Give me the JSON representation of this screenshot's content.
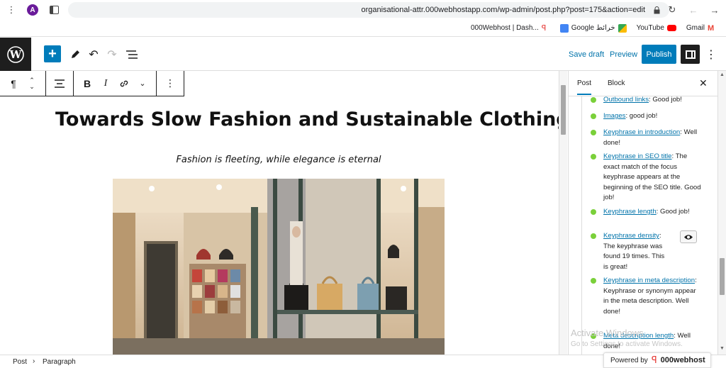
{
  "browser": {
    "url": "organisational-attr.000webhostapp.com/wp-admin/post.php?post=175&action=edit",
    "avatar_letter": "A",
    "bookmarks": [
      {
        "label": "000Webhost | Dash...",
        "icon": "webhost-icon",
        "color": "#e53935"
      },
      {
        "label": "Google خرائط",
        "icon": "maps-icon",
        "color": "#4285f4"
      },
      {
        "label": "YouTube",
        "icon": "youtube-icon",
        "color": "#ff0000"
      },
      {
        "label": "Gmail",
        "icon": "gmail-icon",
        "color": "#ea4335"
      }
    ]
  },
  "header": {
    "save_draft": "Save draft",
    "preview": "Preview",
    "publish": "Publish"
  },
  "post": {
    "title": "Towards Slow Fashion and Sustainable Clothing",
    "tagline": "Fashion is fleeting, while elegance is eternal"
  },
  "sidebar": {
    "tabs": [
      "Post",
      "Block"
    ],
    "items": [
      {
        "link": "Outbound links",
        "text": ": Good job!"
      },
      {
        "link": "Images",
        "text": ": good job!"
      },
      {
        "link": "Keyphrase in introduction",
        "text": ": Well done!"
      },
      {
        "link": "Keyphrase in SEO title",
        "text": ": The exact match of the focus keyphrase appears at the beginning of the SEO title. Good job!"
      },
      {
        "link": "Keyphrase length",
        "text": ": Good job!"
      },
      {
        "link": "Keyphrase density",
        "text": ": The keyphrase was found 19 times. This is great!"
      },
      {
        "link": "Keyphrase in meta description",
        "text": ": Keyphrase or synonym appear in the meta description. Well done!"
      },
      {
        "link": "Meta description length",
        "text": ": Well done!"
      }
    ]
  },
  "watermark": {
    "title": "Activate Windows",
    "subtitle": "Go to Settings to activate Windows."
  },
  "footer": {
    "breadcrumb": [
      "Post",
      "Paragraph"
    ],
    "powered_by": "Powered by",
    "powered_brand": "000webhost"
  },
  "colors": {
    "accent": "#007cba",
    "good": "#7ad03a",
    "link": "#0073aa"
  }
}
